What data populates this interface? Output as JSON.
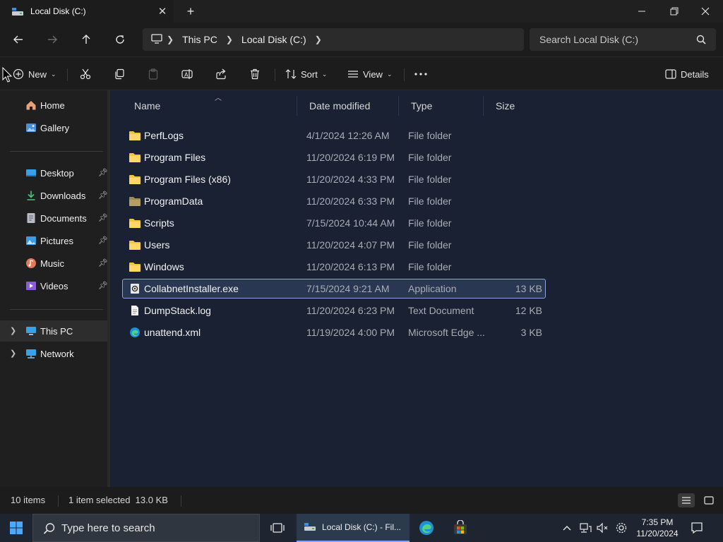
{
  "window": {
    "tab_title": "Local Disk (C:)",
    "new_tab_symbol": "+"
  },
  "address": {
    "crumbs": [
      "This PC",
      "Local Disk (C:)"
    ],
    "search_placeholder": "Search Local Disk (C:)"
  },
  "commandbar": {
    "new_label": "New",
    "sort_label": "Sort",
    "view_label": "View",
    "details_label": "Details"
  },
  "nav": {
    "home": "Home",
    "gallery": "Gallery",
    "desktop": "Desktop",
    "downloads": "Downloads",
    "documents": "Documents",
    "pictures": "Pictures",
    "music": "Music",
    "videos": "Videos",
    "this_pc": "This PC",
    "network": "Network"
  },
  "columns": {
    "name": "Name",
    "date": "Date modified",
    "type": "Type",
    "size": "Size"
  },
  "files": [
    {
      "name": "PerfLogs",
      "date": "4/1/2024 12:26 AM",
      "type": "File folder",
      "size": "",
      "icon": "folder-icon"
    },
    {
      "name": "Program Files",
      "date": "11/20/2024 6:19 PM",
      "type": "File folder",
      "size": "",
      "icon": "folder-icon"
    },
    {
      "name": "Program Files (x86)",
      "date": "11/20/2024 4:33 PM",
      "type": "File folder",
      "size": "",
      "icon": "folder-icon"
    },
    {
      "name": "ProgramData",
      "date": "11/20/2024 6:33 PM",
      "type": "File folder",
      "size": "",
      "icon": "hidden-folder-icon"
    },
    {
      "name": "Scripts",
      "date": "7/15/2024 10:44 AM",
      "type": "File folder",
      "size": "",
      "icon": "folder-icon"
    },
    {
      "name": "Users",
      "date": "11/20/2024 4:07 PM",
      "type": "File folder",
      "size": "",
      "icon": "folder-icon"
    },
    {
      "name": "Windows",
      "date": "11/20/2024 6:13 PM",
      "type": "File folder",
      "size": "",
      "icon": "folder-icon"
    },
    {
      "name": "CollabnetInstaller.exe",
      "date": "7/15/2024 9:21 AM",
      "type": "Application",
      "size": "13 KB",
      "icon": "exe-icon",
      "selected": true
    },
    {
      "name": "DumpStack.log",
      "date": "11/20/2024 6:23 PM",
      "type": "Text Document",
      "size": "12 KB",
      "icon": "text-file-icon"
    },
    {
      "name": "unattend.xml",
      "date": "11/19/2024 4:00 PM",
      "type": "Microsoft Edge ...",
      "size": "3 KB",
      "icon": "edge-icon"
    }
  ],
  "status": {
    "item_count": "10 items",
    "selection": "1 item selected  13.0 KB"
  },
  "taskbar": {
    "search_placeholder": "Type here to search",
    "explorer_label": "Local Disk (C:) - Fil...",
    "time": "7:35 PM",
    "date": "11/20/2024"
  },
  "colors": {
    "accent": "#7aa8ff",
    "folder": "#f4c542",
    "selection_border": "#8aa6d6",
    "list_background": "#192133"
  }
}
